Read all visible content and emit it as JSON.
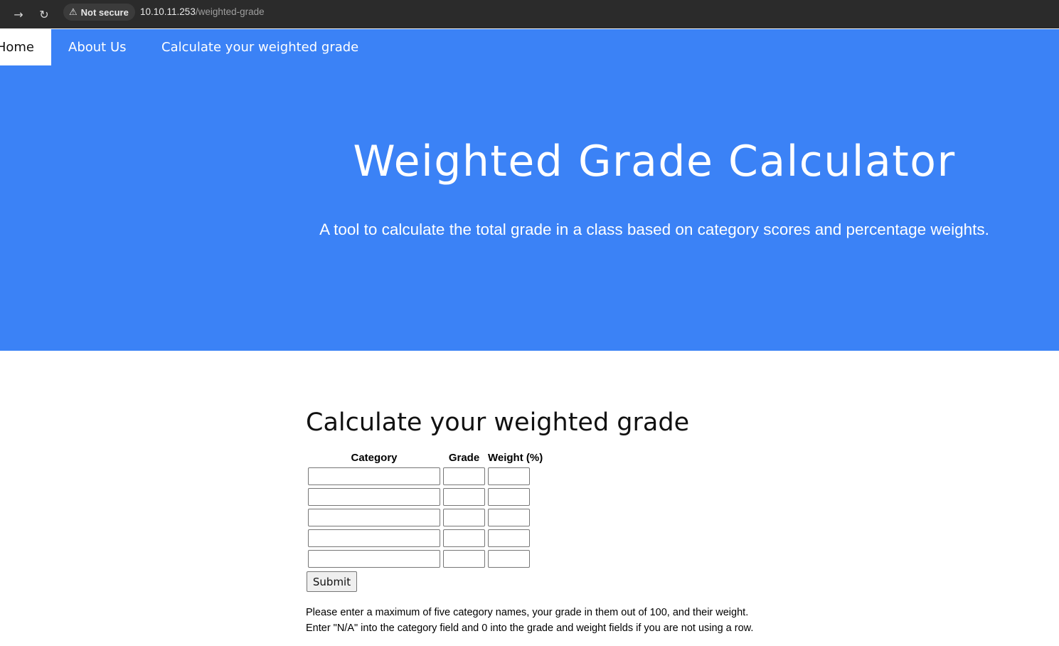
{
  "browser": {
    "forward_icon": "→",
    "reload_icon": "↻",
    "security_icon": "⚠",
    "security_label": "Not secure",
    "url_host": "10.10.11.253",
    "url_path": "/weighted-grade"
  },
  "nav": {
    "home_label": "Home",
    "about_label": "About Us",
    "calc_label": "Calculate your weighted grade",
    "accent_color": "#3b82f6"
  },
  "hero": {
    "title": "Weighted Grade Calculator",
    "subtitle": "A tool to calculate the total grade in a class based on category scores and percentage weights."
  },
  "form": {
    "heading": "Calculate your weighted grade",
    "columns": [
      "Category",
      "Grade",
      "Weight (%)"
    ],
    "rows": [
      {
        "category": "",
        "grade": "",
        "weight": ""
      },
      {
        "category": "",
        "grade": "",
        "weight": ""
      },
      {
        "category": "",
        "grade": "",
        "weight": ""
      },
      {
        "category": "",
        "grade": "",
        "weight": ""
      },
      {
        "category": "",
        "grade": "",
        "weight": ""
      }
    ],
    "submit_label": "Submit",
    "note_line1": "Please enter a maximum of five category names, your grade in them out of 100, and their weight.",
    "note_line2": "Enter \"N/A\" into the category field and 0 into the grade and weight fields if you are not using a row."
  }
}
